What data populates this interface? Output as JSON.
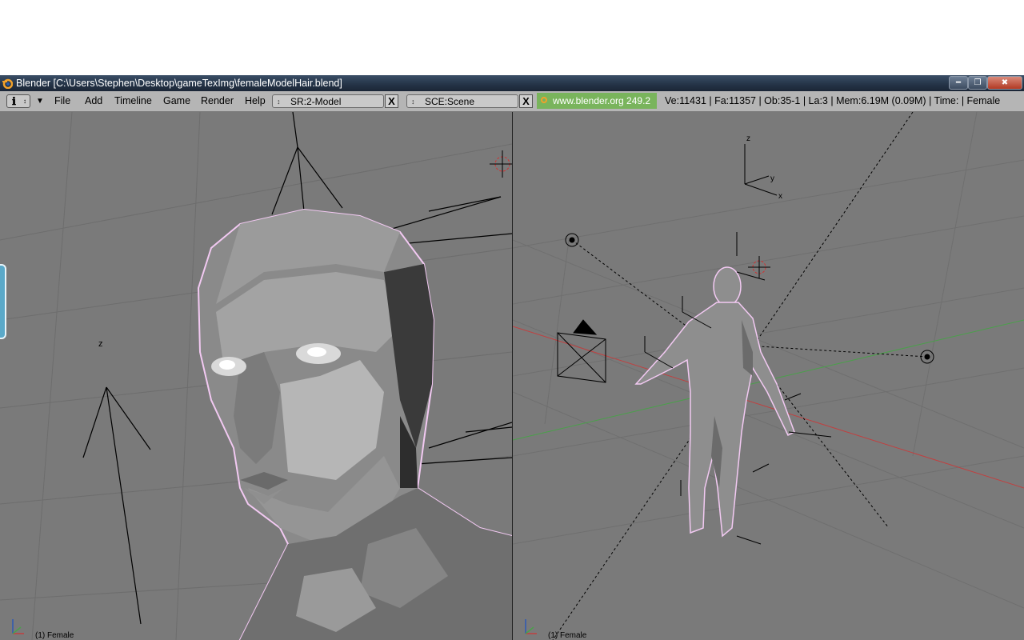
{
  "window": {
    "title": "Blender [C:\\Users\\Stephen\\Desktop\\gameTexImg\\femaleModelHair.blend]",
    "minimize_icon": "minimize-icon",
    "maximize_icon": "maximize-icon",
    "close_icon": "close-icon"
  },
  "header": {
    "menus": [
      "File",
      "Add",
      "Timeline",
      "Game",
      "Render",
      "Help"
    ],
    "screen_field": "SR:2-Model",
    "scene_field": "SCE:Scene",
    "url": "www.blender.org 249.2",
    "stats": "Ve:11431 | Fa:11357 | Ob:35-1 | La:3  | Mem:6.19M (0.09M)  | Time: | Female",
    "clear_label": "X"
  },
  "viewports": {
    "left": {
      "object_label": "(1) Female",
      "axis_label": "z"
    },
    "right": {
      "object_label": "(1) Female"
    }
  },
  "colors": {
    "viewport_bg": "#7a7a7a",
    "header_bg": "#b5b5b5",
    "url_bg": "#79b45c",
    "x_axis": "#c04040",
    "y_axis": "#4aa04a"
  }
}
